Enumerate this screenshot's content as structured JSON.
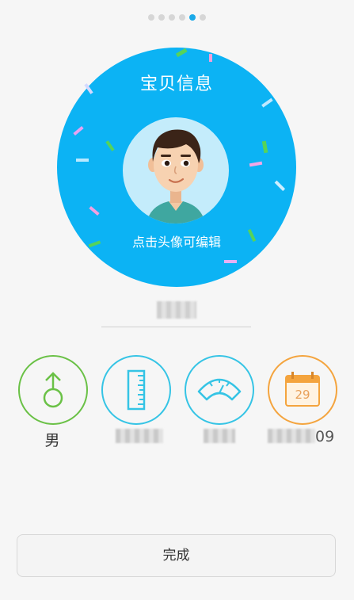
{
  "pager": {
    "count": 6,
    "active_index": 4
  },
  "card": {
    "title": "宝贝信息",
    "avatar_hint": "点击头像可编辑",
    "avatar_icon": "boy-avatar-icon",
    "color": "#0cb3f4"
  },
  "attributes": [
    {
      "key": "gender",
      "icon": "male-symbol-icon",
      "value": "男",
      "color": "#6ac146"
    },
    {
      "key": "height",
      "icon": "ruler-icon",
      "value": "",
      "color": "#35c4e5"
    },
    {
      "key": "weight",
      "icon": "scale-gauge-icon",
      "value": "",
      "color": "#35c4e5"
    },
    {
      "key": "birthday",
      "icon": "calendar-icon",
      "calendar_day": "29",
      "value_suffix": "09",
      "color": "#f4a43e"
    }
  ],
  "actions": {
    "done_label": "完成"
  }
}
